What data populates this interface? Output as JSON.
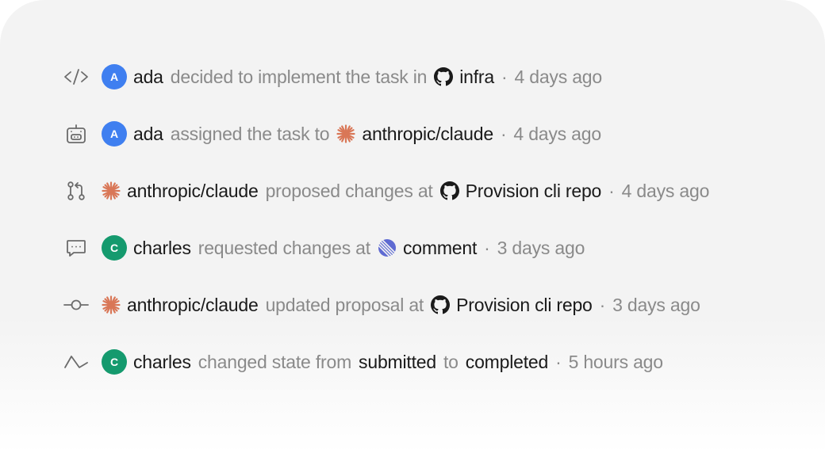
{
  "colors": {
    "avatar_a": "#3f7ff0",
    "avatar_c": "#159a6e",
    "spark": "#d97757",
    "linear": "#5e6ad2",
    "muted": "#8a8a8a",
    "text": "#1a1a1a"
  },
  "activity": [
    {
      "type_icon": "code-icon",
      "actor_initial": "A",
      "actor": "ada",
      "action": "decided to implement the task in",
      "ref_icon": "github-icon",
      "ref": "infra",
      "separator": "·",
      "time": "4 days ago"
    },
    {
      "type_icon": "robot-icon",
      "actor_initial": "A",
      "actor": "ada",
      "action": "assigned the task to",
      "ref_icon": "claude-spark-icon",
      "ref": "anthropic/claude",
      "separator": "·",
      "time": "4 days ago"
    },
    {
      "type_icon": "pull-request-icon",
      "actor_icon": "claude-spark-icon",
      "actor": "anthropic/claude",
      "action": "proposed changes at",
      "ref_icon": "github-icon",
      "ref": "Provision cli repo",
      "separator": "·",
      "time": "4 days ago"
    },
    {
      "type_icon": "comment-icon",
      "actor_initial": "C",
      "actor": "charles",
      "action": "requested changes at",
      "ref_icon": "linear-icon",
      "ref": "comment",
      "separator": "·",
      "time": "3 days ago"
    },
    {
      "type_icon": "commit-icon",
      "actor_icon": "claude-spark-icon",
      "actor": "anthropic/claude",
      "action": "updated proposal at",
      "ref_icon": "github-icon",
      "ref": "Provision cli repo",
      "separator": "·",
      "time": "3 days ago"
    },
    {
      "type_icon": "state-change-icon",
      "actor_initial": "C",
      "actor": "charles",
      "action": "changed state from",
      "from_state": "submitted",
      "connector": "to",
      "to_state": "completed",
      "separator": "·",
      "time": "5 hours ago"
    }
  ]
}
